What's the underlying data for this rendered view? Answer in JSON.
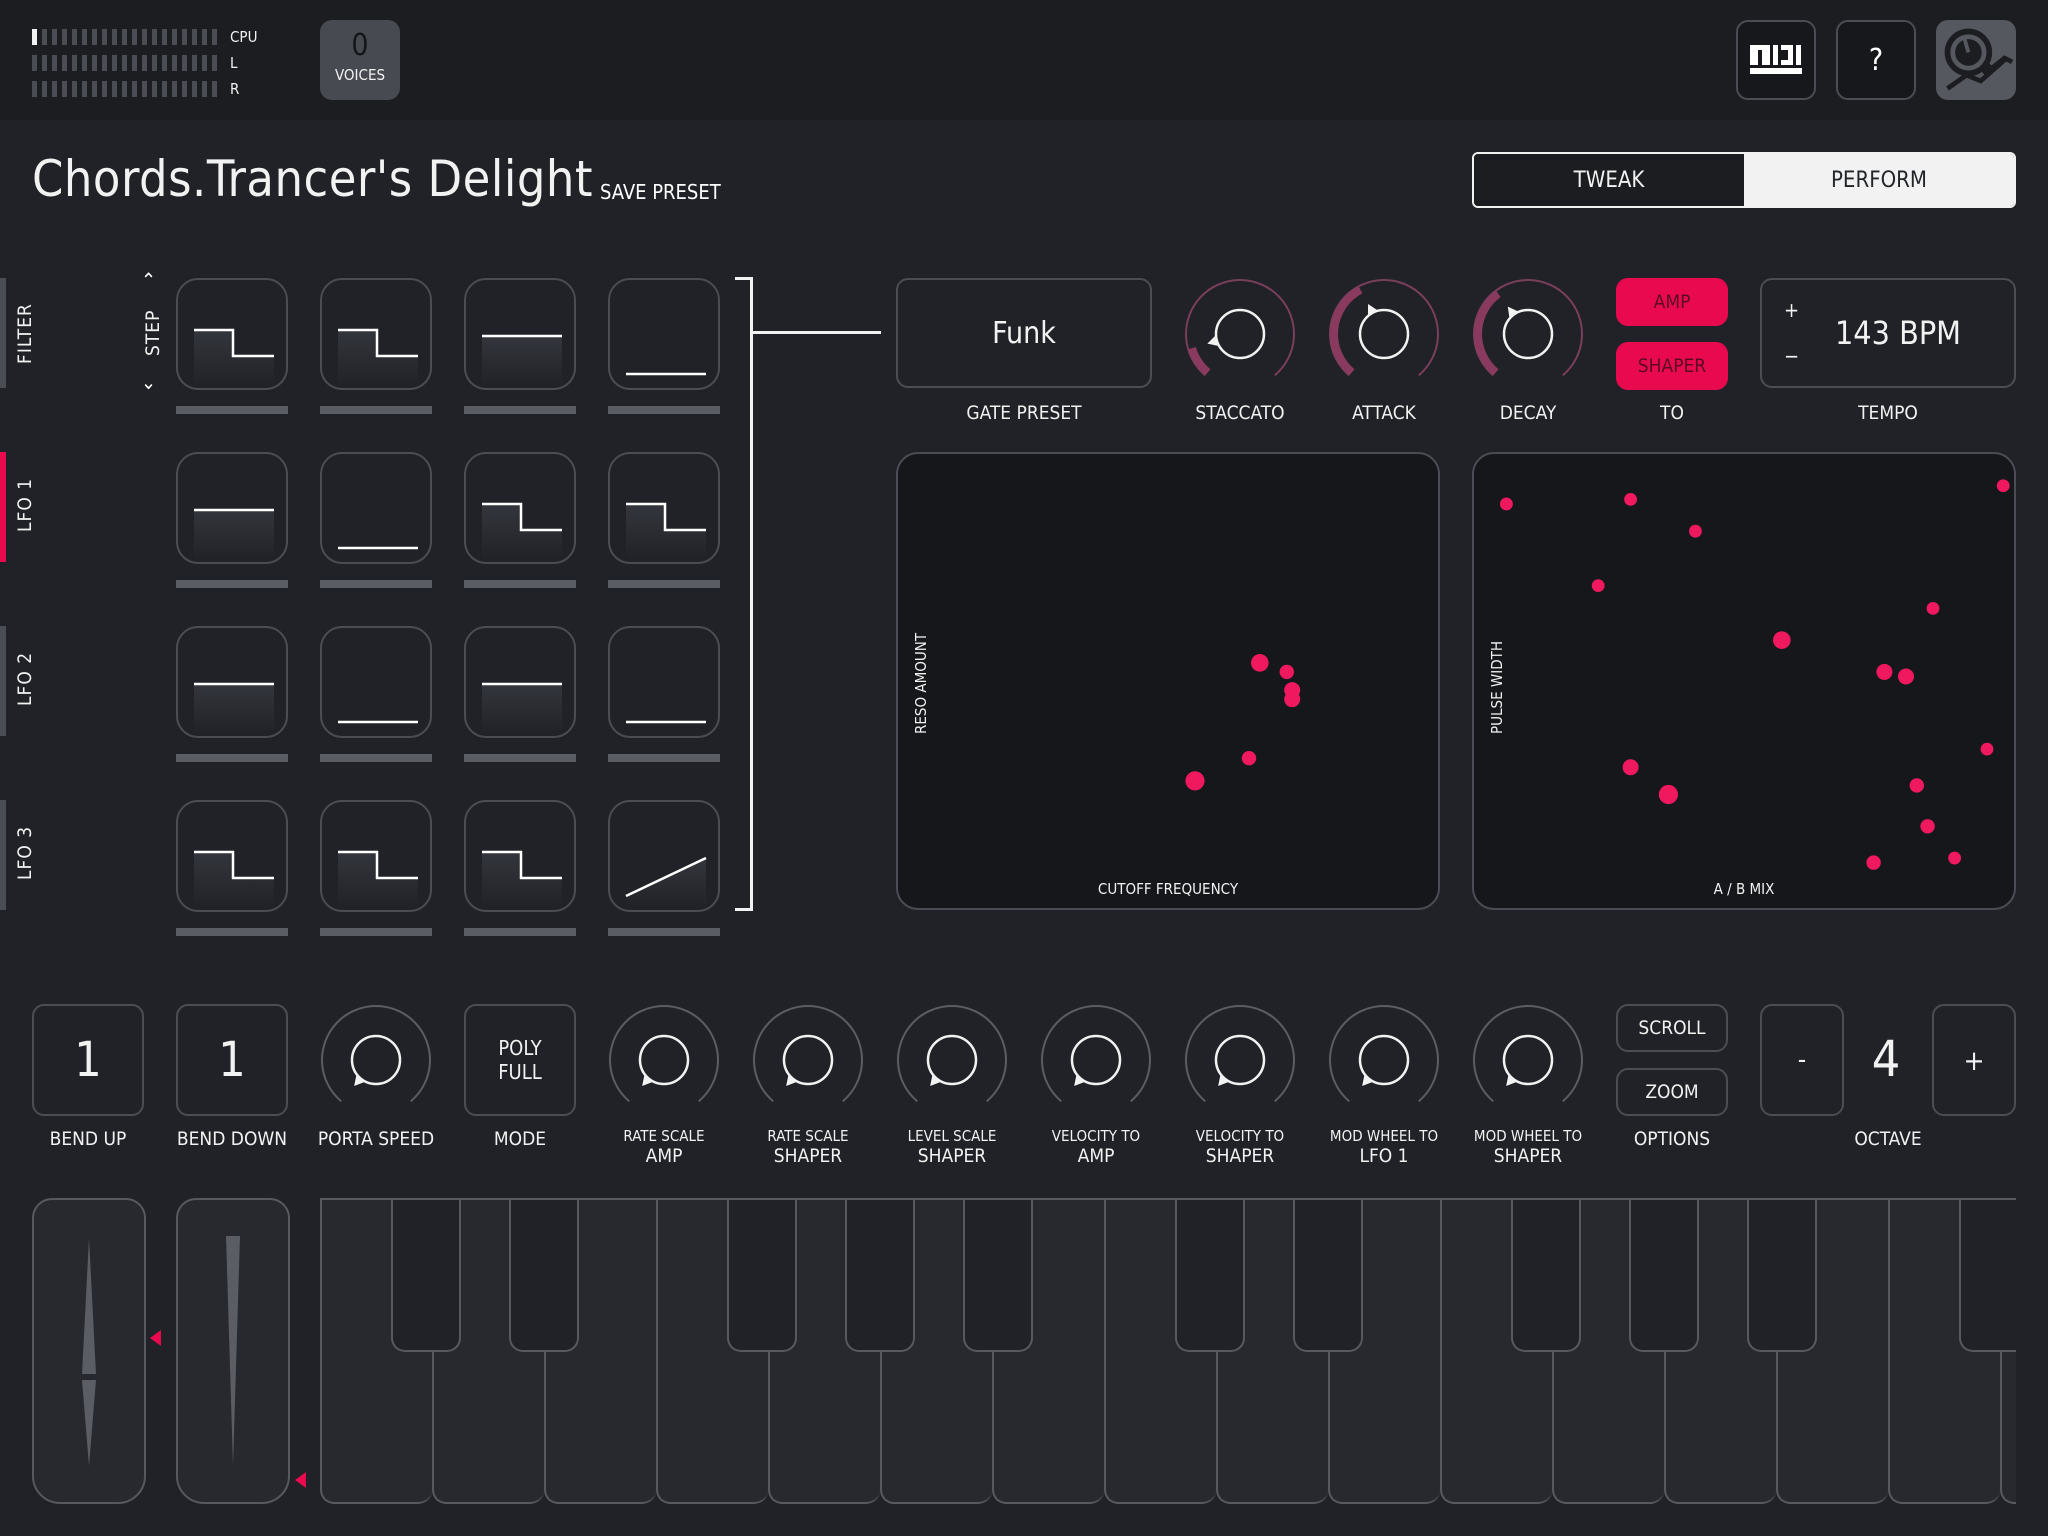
{
  "meters": {
    "rows": [
      {
        "label": "CPU",
        "segments": 19,
        "lit": 1
      },
      {
        "label": "L",
        "segments": 19,
        "lit": 0
      },
      {
        "label": "R",
        "segments": 19,
        "lit": 0
      }
    ]
  },
  "voices": {
    "count": "0",
    "label": "VOICES"
  },
  "toolbar": {
    "midi_label": "MIDI",
    "help_label": "?"
  },
  "preset": {
    "title": "Chords.Trancer's Delight",
    "save_label": "SAVE PRESET"
  },
  "mode_toggle": {
    "tweak": "TWEAK",
    "perform": "PERFORM",
    "selected": "PERFORM"
  },
  "sidebar": {
    "step_label": "STEP",
    "tabs": [
      {
        "label": "FILTER",
        "active": false
      },
      {
        "label": "LFO 1",
        "active": true
      },
      {
        "label": "LFO 2",
        "active": false
      },
      {
        "label": "LFO 3",
        "active": false
      }
    ]
  },
  "step_grid": {
    "rows": [
      [
        "step-down",
        "step-down",
        "high",
        "low"
      ],
      [
        "high",
        "low",
        "step-down",
        "step-down"
      ],
      [
        "high",
        "low",
        "high",
        "low"
      ],
      [
        "step-down",
        "step-down",
        "step-down",
        "ramp-up"
      ]
    ]
  },
  "gate": {
    "preset_value": "Funk",
    "preset_label": "GATE PRESET",
    "knobs": [
      {
        "label": "STACCATO",
        "value": 0.12
      },
      {
        "label": "ATTACK",
        "value": 0.4
      },
      {
        "label": "DECAY",
        "value": 0.37
      }
    ],
    "to_label": "TO",
    "to_buttons": [
      {
        "label": "AMP",
        "active": true
      },
      {
        "label": "SHAPER",
        "active": true
      }
    ]
  },
  "tempo": {
    "value": "143 BPM",
    "label": "TEMPO",
    "plus": "+",
    "minus": "−"
  },
  "pads": [
    {
      "x_label": "CUTOFF FREQUENCY",
      "y_label": "RESO AMOUNT",
      "points": [
        [
          0.67,
          0.46,
          1.1
        ],
        [
          0.72,
          0.48,
          0.9
        ],
        [
          0.73,
          0.52,
          1.0
        ],
        [
          0.73,
          0.54,
          1.0
        ],
        [
          0.65,
          0.67,
          0.9
        ],
        [
          0.55,
          0.72,
          1.2
        ]
      ]
    },
    {
      "x_label": "A / B MIX",
      "y_label": "PULSE WIDTH",
      "points": [
        [
          0.06,
          0.11,
          0.8
        ],
        [
          0.29,
          0.1,
          0.8
        ],
        [
          0.41,
          0.17,
          0.8
        ],
        [
          0.23,
          0.29,
          0.8
        ],
        [
          0.98,
          0.07,
          0.8
        ],
        [
          0.85,
          0.34,
          0.8
        ],
        [
          0.57,
          0.41,
          1.1
        ],
        [
          0.76,
          0.48,
          1.0
        ],
        [
          0.8,
          0.49,
          1.0
        ],
        [
          0.95,
          0.65,
          0.8
        ],
        [
          0.29,
          0.69,
          1.0
        ],
        [
          0.36,
          0.75,
          1.2
        ],
        [
          0.82,
          0.73,
          0.9
        ],
        [
          0.84,
          0.82,
          0.9
        ],
        [
          0.89,
          0.89,
          0.8
        ],
        [
          0.74,
          0.9,
          0.9
        ]
      ]
    }
  ],
  "controls": {
    "bend_up": {
      "value": "1",
      "label": "BEND UP"
    },
    "bend_down": {
      "value": "1",
      "label": "BEND DOWN"
    },
    "porta": {
      "label": "PORTA SPEED",
      "value": 0
    },
    "mode": {
      "line1": "POLY",
      "line2": "FULL",
      "label": "MODE"
    },
    "knobs": [
      {
        "small": "RATE SCALE",
        "big": "AMP",
        "value": 0
      },
      {
        "small": "RATE SCALE",
        "big": "SHAPER",
        "value": 0
      },
      {
        "small": "LEVEL SCALE",
        "big": "SHAPER",
        "value": 0
      },
      {
        "small": "VELOCITY TO",
        "big": "AMP",
        "value": 0
      },
      {
        "small": "VELOCITY TO",
        "big": "SHAPER",
        "value": 0
      },
      {
        "small": "MOD WHEEL TO",
        "big": "LFO 1",
        "value": 0
      },
      {
        "small": "MOD WHEEL TO",
        "big": "SHAPER",
        "value": 0
      }
    ],
    "options": {
      "scroll": "SCROLL",
      "zoom": "ZOOM",
      "label": "OPTIONS"
    },
    "octave": {
      "minus": "-",
      "value": "4",
      "plus": "+",
      "label": "OCTAVE"
    }
  },
  "keyboard": {
    "start_note": "C",
    "white_keys": 16
  },
  "colors": {
    "accent": "#e8094f",
    "knob_arc": "#8a3a5e",
    "background": "#202227"
  }
}
